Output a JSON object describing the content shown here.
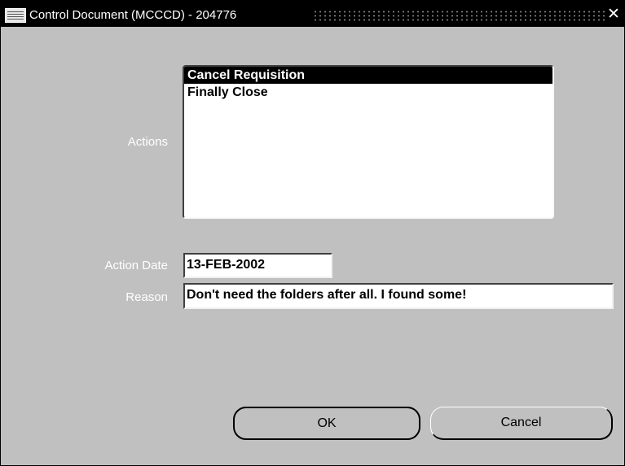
{
  "window": {
    "title": "Control Document (MCCCD) - 204776",
    "close_glyph": "✕"
  },
  "actions": {
    "label": "Actions",
    "items": [
      {
        "label": "Cancel Requisition",
        "selected": true
      },
      {
        "label": "Finally Close",
        "selected": false
      }
    ]
  },
  "action_date": {
    "label": "Action Date",
    "value": "13-FEB-2002"
  },
  "reason": {
    "label": "Reason",
    "value": "Don't need the folders after all.  I found some!"
  },
  "buttons": {
    "ok_label": "OK",
    "cancel_label": "Cancel"
  },
  "colors": {
    "background": "#c0c0c0",
    "titlebar": "#000000",
    "selection": "#000000"
  },
  "icons": {
    "app": "oracle-app-icon",
    "close": "close-icon"
  }
}
